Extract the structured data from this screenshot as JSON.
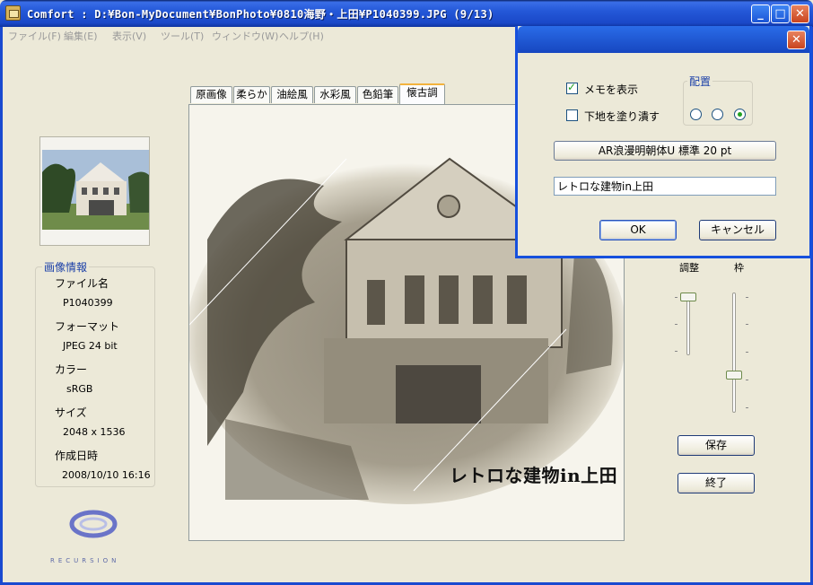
{
  "window": {
    "title": "Comfort : D:¥Bon-MyDocument¥BonPhoto¥0810海野・上田¥P1040399.JPG (9/13)",
    "min_label": "_",
    "max_label": "□",
    "close_label": "✕"
  },
  "menu": [
    "ファイル(F)",
    "編集(E)",
    "表示(V)",
    "ツール(T)",
    "ウィンドウ(W)",
    "ヘルプ(H)"
  ],
  "info": {
    "legend": "画像情報",
    "filename_label": "ファイル名",
    "filename": "P1040399",
    "format_label": "フォーマット",
    "format": "JPEG  24 bit",
    "color_label": "カラー",
    "color": "sRGB",
    "size_label": "サイズ",
    "size": "2048 x 1536",
    "date_label": "作成日時",
    "date": "2008/10/10 16:16"
  },
  "logo_text": "RECURSION",
  "tabs": [
    "原画像",
    "柔らか",
    "油絵風",
    "水彩風",
    "色鉛筆",
    "懐古調"
  ],
  "active_tab": 5,
  "canvas": {
    "caption": "レトロな建物in上田"
  },
  "sliders": {
    "adjust_label": "調整",
    "frame_label": "枠",
    "adjust_value": 0.0,
    "frame_value": 0.7
  },
  "buttons": {
    "save": "保存",
    "exit": "終了"
  },
  "dialog": {
    "close_label": "✕",
    "show_memo": "メモを表示",
    "show_memo_checked": true,
    "fill_bg": "下地を塗り潰す",
    "fill_bg_checked": false,
    "placement_legend": "配置",
    "placement_selected": 2,
    "font_button": "AR浪漫明朝体U  標準   20 pt",
    "memo_text": "レトロな建物in上田",
    "ok": "OK",
    "cancel": "キャンセル"
  }
}
